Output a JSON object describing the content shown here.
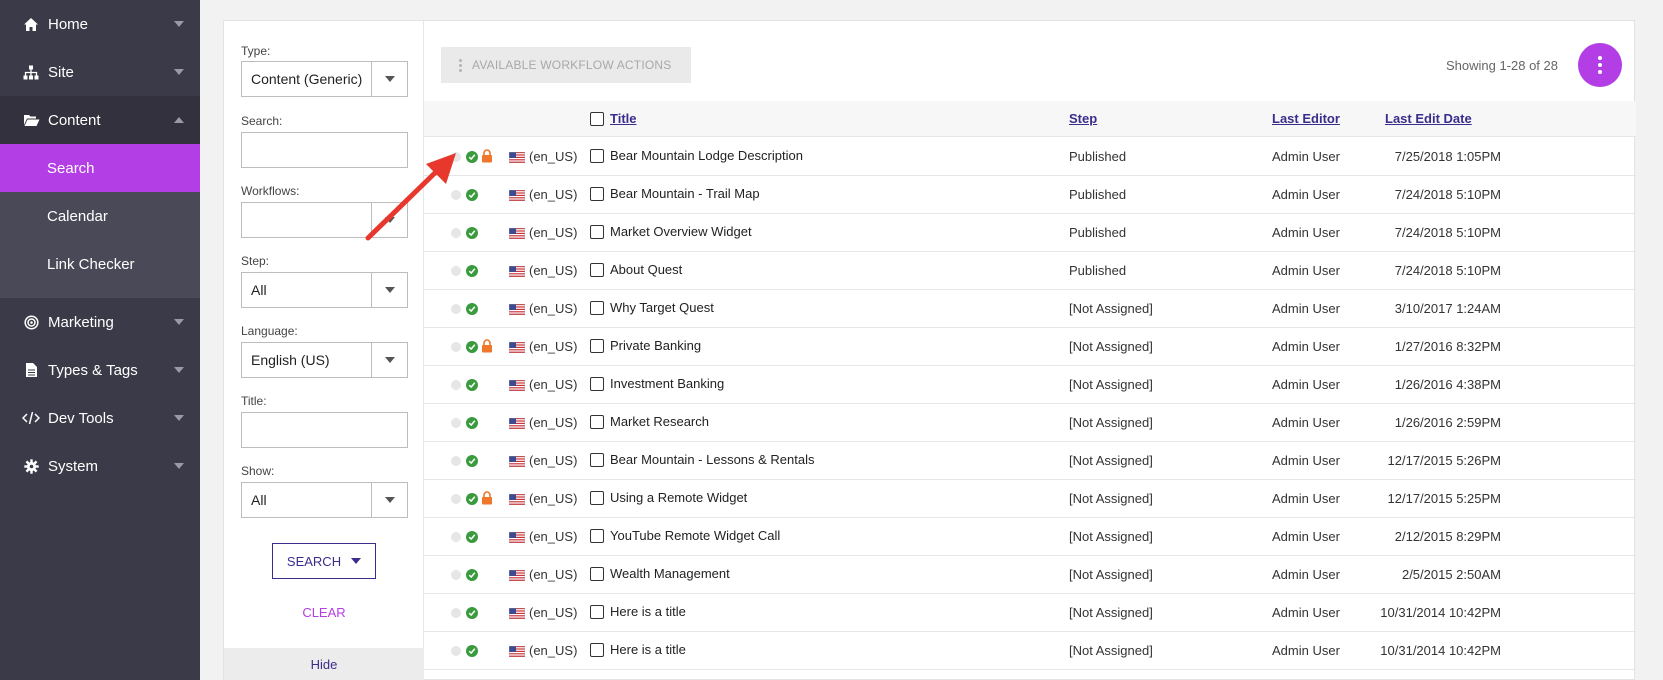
{
  "sidebar": {
    "items": [
      {
        "label": "Home",
        "icon": "home-icon"
      },
      {
        "label": "Site",
        "icon": "sitemap-icon"
      },
      {
        "label": "Content",
        "icon": "folder-open-icon"
      },
      {
        "label": "Marketing",
        "icon": "target-icon"
      },
      {
        "label": "Types & Tags",
        "icon": "file-icon"
      },
      {
        "label": "Dev Tools",
        "icon": "code-icon"
      },
      {
        "label": "System",
        "icon": "gear-icon"
      }
    ],
    "content_sub": [
      {
        "label": "Search"
      },
      {
        "label": "Calendar"
      },
      {
        "label": "Link Checker"
      }
    ]
  },
  "filters": {
    "type_label": "Type:",
    "type_value": "Content (Generic)",
    "search_label": "Search:",
    "search_value": "",
    "workflows_label": "Workflows:",
    "workflows_value": "",
    "step_label": "Step:",
    "step_value": "All",
    "language_label": "Language:",
    "language_value": "English (US)",
    "title_label": "Title:",
    "title_value": "",
    "show_label": "Show:",
    "show_value": "All",
    "search_button": "SEARCH",
    "clear_link": "CLEAR",
    "hide_link": "Hide"
  },
  "toolbar": {
    "workflow_actions": "AVAILABLE WORKFLOW ACTIONS",
    "showing": "Showing 1-28 of 28"
  },
  "table": {
    "headers": {
      "title": "Title",
      "step": "Step",
      "last_editor": "Last Editor",
      "last_edit_date": "Last Edit Date"
    },
    "rows": [
      {
        "locked": true,
        "locale": "(en_US)",
        "title": "Bear Mountain Lodge Description",
        "step": "Published",
        "editor": "Admin User",
        "date": "7/25/2018 1:05PM"
      },
      {
        "locked": false,
        "locale": "(en_US)",
        "title": "Bear Mountain - Trail Map",
        "step": "Published",
        "editor": "Admin User",
        "date": "7/24/2018 5:10PM"
      },
      {
        "locked": false,
        "locale": "(en_US)",
        "title": "Market Overview Widget",
        "step": "Published",
        "editor": "Admin User",
        "date": "7/24/2018 5:10PM"
      },
      {
        "locked": false,
        "locale": "(en_US)",
        "title": "About Quest",
        "step": "Published",
        "editor": "Admin User",
        "date": "7/24/2018 5:10PM"
      },
      {
        "locked": false,
        "locale": "(en_US)",
        "title": "Why Target Quest",
        "step": "[Not Assigned]",
        "editor": "Admin User",
        "date": "3/10/2017 1:24AM"
      },
      {
        "locked": true,
        "locale": "(en_US)",
        "title": "Private Banking",
        "step": "[Not Assigned]",
        "editor": "Admin User",
        "date": "1/27/2016 8:32PM"
      },
      {
        "locked": false,
        "locale": "(en_US)",
        "title": "Investment Banking",
        "step": "[Not Assigned]",
        "editor": "Admin User",
        "date": "1/26/2016 4:38PM"
      },
      {
        "locked": false,
        "locale": "(en_US)",
        "title": "Market Research",
        "step": "[Not Assigned]",
        "editor": "Admin User",
        "date": "1/26/2016 2:59PM"
      },
      {
        "locked": false,
        "locale": "(en_US)",
        "title": "Bear Mountain - Lessons & Rentals",
        "step": "[Not Assigned]",
        "editor": "Admin User",
        "date": "12/17/2015 5:26PM"
      },
      {
        "locked": true,
        "locale": "(en_US)",
        "title": "Using a Remote Widget",
        "step": "[Not Assigned]",
        "editor": "Admin User",
        "date": "12/17/2015 5:25PM"
      },
      {
        "locked": false,
        "locale": "(en_US)",
        "title": "YouTube Remote Widget Call",
        "step": "[Not Assigned]",
        "editor": "Admin User",
        "date": "2/12/2015 8:29PM"
      },
      {
        "locked": false,
        "locale": "(en_US)",
        "title": "Wealth Management",
        "step": "[Not Assigned]",
        "editor": "Admin User",
        "date": "2/5/2015 2:50AM"
      },
      {
        "locked": false,
        "locale": "(en_US)",
        "title": "Here is a title",
        "step": "[Not Assigned]",
        "editor": "Admin User",
        "date": "10/31/2014 10:42PM"
      },
      {
        "locked": false,
        "locale": "(en_US)",
        "title": "Here is a title",
        "step": "[Not Assigned]",
        "editor": "Admin User",
        "date": "10/31/2014 10:42PM"
      }
    ]
  },
  "colors": {
    "accent": "#b33ee6",
    "sidebar": "#3b3a48",
    "link": "#3a2e8c",
    "published_green": "#3a9b3e",
    "lock_orange": "#f0762b",
    "annotation_arrow": "#e8382d"
  }
}
